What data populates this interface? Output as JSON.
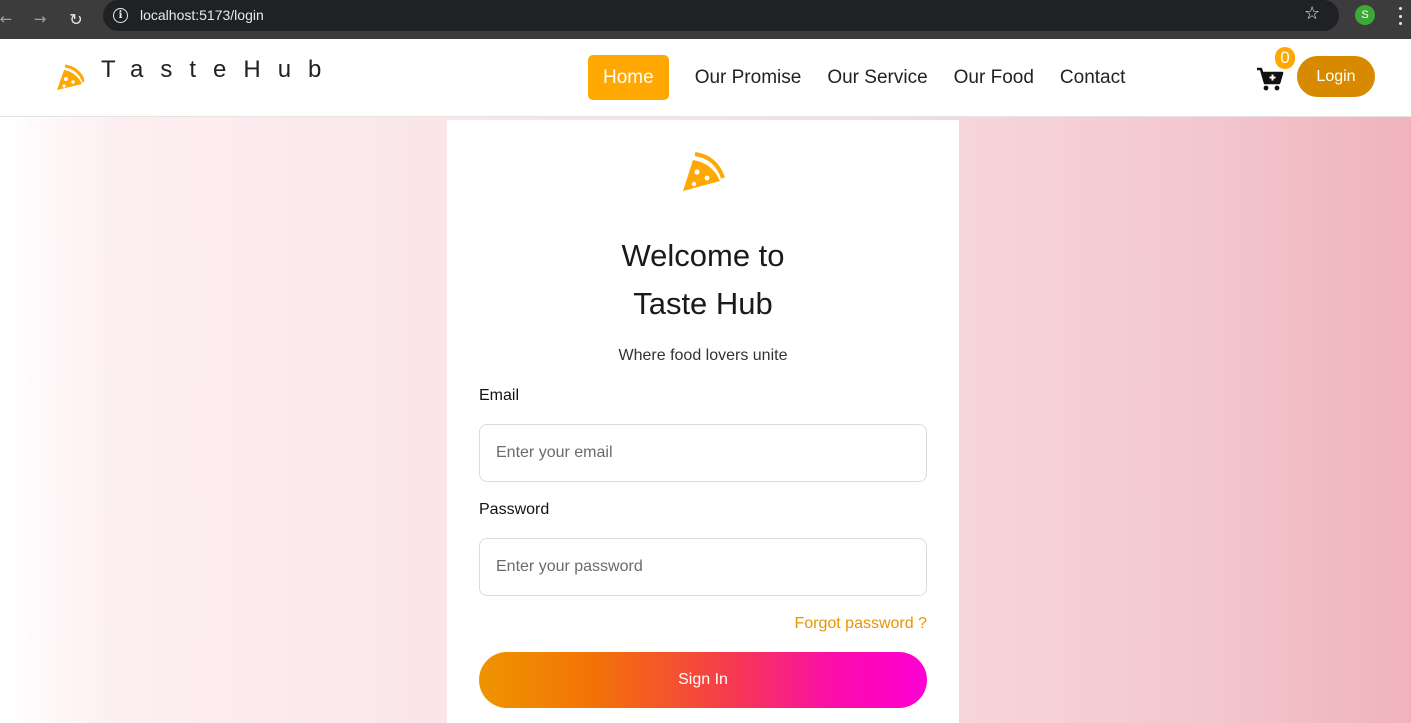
{
  "browser": {
    "url": "localhost:5173/login",
    "back_icon": "←",
    "forward_icon": "→",
    "reload_icon": "↻",
    "info_icon": "i",
    "star_icon": "☆",
    "profile_initial": "S"
  },
  "header": {
    "brand": "TasteHub",
    "nav": {
      "home": "Home",
      "promise": "Our Promise",
      "service": "Our Service",
      "food": "Our Food",
      "contact": "Contact"
    },
    "cart_count": "0",
    "login_label": "Login",
    "accent_color": "#ffa801"
  },
  "login_card": {
    "title_line1": "Welcome to",
    "title_line2": "Taste Hub",
    "subtitle": "Where food lovers unite",
    "email_label": "Email",
    "email_placeholder": "Enter your email",
    "password_label": "Password",
    "password_placeholder": "Enter your password",
    "forgot_label": "Forgot password ?",
    "signin_label": "Sign In"
  }
}
